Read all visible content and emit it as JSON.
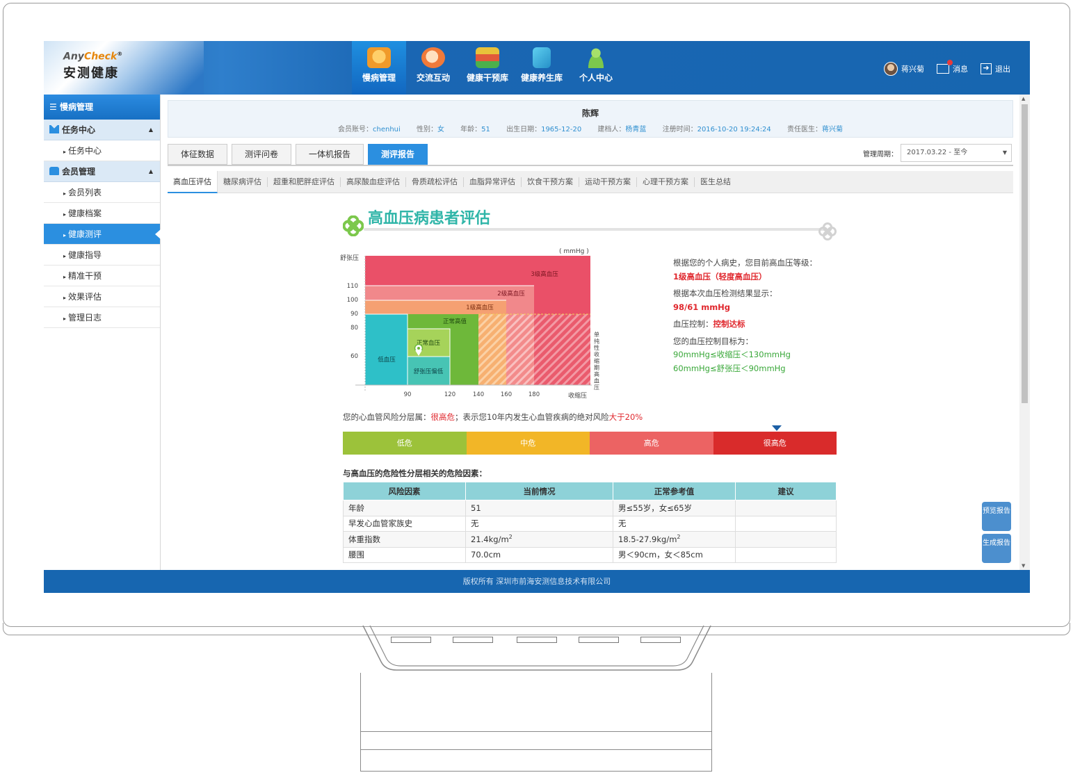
{
  "logo": {
    "en_any": "Any",
    "en_check": "Check",
    "reg": "®",
    "cn": "安测健康"
  },
  "nav": {
    "items": [
      {
        "label": "慢病管理",
        "icon": "heart-shield-icon",
        "color": "#f0a33a"
      },
      {
        "label": "交流互动",
        "icon": "chat-bubbles-icon",
        "color": "#f07a3a"
      },
      {
        "label": "健康干预库",
        "icon": "books-icon",
        "color": "#e8c23a"
      },
      {
        "label": "健康养生库",
        "icon": "medical-book-icon",
        "color": "#38b0d8"
      },
      {
        "label": "个人中心",
        "icon": "user-icon",
        "color": "#7cc84c"
      }
    ]
  },
  "topright": {
    "user": "蒋兴菊",
    "messages": "消息",
    "logout": "退出"
  },
  "sidebar": {
    "title": "慢病管理",
    "groups": [
      {
        "label": "任务中心",
        "items": [
          "任务中心"
        ]
      },
      {
        "label": "会员管理",
        "items": [
          "会员列表",
          "健康档案",
          "健康测评",
          "健康指导",
          "精准干预",
          "效果评估",
          "管理日志"
        ]
      }
    ]
  },
  "member": {
    "name": "陈辉",
    "account_label": "会员账号：",
    "account": "chenhui",
    "gender_label": "性别：",
    "gender": "女",
    "age_label": "年龄：",
    "age": "51",
    "birth_label": "出生日期：",
    "birth": "1965-12-20",
    "creator_label": "建档人：",
    "creator": "杨青蓝",
    "reg_label": "注册时间：",
    "reg": "2016-10-20 19:24:24",
    "doctor_label": "责任医生：",
    "doctor": "蒋兴菊"
  },
  "tabs": [
    "体征数据",
    "测评问卷",
    "一体机报告",
    "测评报告"
  ],
  "period": {
    "label": "管理周期：",
    "value": "2017.03.22 - 至今"
  },
  "subtabs": [
    "高血压评估",
    "糖尿病评估",
    "超重和肥胖症评估",
    "高尿酸血症评估",
    "骨质疏松评估",
    "血脂异常评估",
    "饮食干预方案",
    "运动干预方案",
    "心理干预方案",
    "医生总结"
  ],
  "report_title": "高血压病患者评估",
  "chart_data": {
    "type": "heatmap",
    "unit": "( mmHg )",
    "ylabel": "舒张压",
    "xlabel": "收缩压",
    "x_ticks": [
      "90",
      "120",
      "140",
      "160",
      "180"
    ],
    "y_ticks": [
      "110",
      "100",
      "90",
      "80",
      "60"
    ],
    "zones": [
      "3级高血压",
      "2级高血压",
      "1级高血压",
      "正常高值",
      "正常血压",
      "低血压",
      "舒张压偏低",
      "单纯性收缩期高血压"
    ],
    "marker": {
      "systolic": 98,
      "diastolic": 61
    }
  },
  "advice": {
    "l1": "根据您的个人病史，您目前高血压等级：",
    "l2": "1级高血压（轻度高血压）",
    "l3": "根据本次血压检测结果显示：",
    "l4": "98/61 mmHg",
    "l5_label": "血压控制：",
    "l5_value": "控制达标",
    "l6": "您的血压控制目标为：",
    "l7": "90mmHg≤收缩压＜130mmHg",
    "l8": "60mmHg≤舒张压＜90mmHg"
  },
  "risk": {
    "prefix": "您的心血管风险分层属：",
    "level": "很高危",
    "middle": "；表示您10年内发生心血管疾病的绝对风险",
    "suffix": "大于20%",
    "segments": [
      {
        "label": "低危",
        "color": "#9cc23a"
      },
      {
        "label": "中危",
        "color": "#f2b627"
      },
      {
        "label": "高危",
        "color": "#ec6363"
      },
      {
        "label": "很高危",
        "color": "#d92b2b"
      }
    ]
  },
  "factors": {
    "title": "与高血压的危险性分层相关的危险因素：",
    "headers": [
      "风险因素",
      "当前情况",
      "正常参考值",
      "建议"
    ],
    "rows": [
      [
        "年龄",
        "51",
        "男≤55岁，女≤65岁",
        ""
      ],
      [
        "早发心血管家族史",
        "无",
        "无",
        ""
      ],
      [
        "体重指数",
        "21.4kg/m",
        "18.5-27.9kg/m",
        ""
      ],
      [
        "腰围",
        "70.0cm",
        "男＜90cm，女＜85cm",
        ""
      ]
    ],
    "bmi_sup": "2"
  },
  "float_buttons": [
    "预览报告",
    "生成报告"
  ],
  "footer": "版权所有 深圳市前海安测信息技术有限公司"
}
